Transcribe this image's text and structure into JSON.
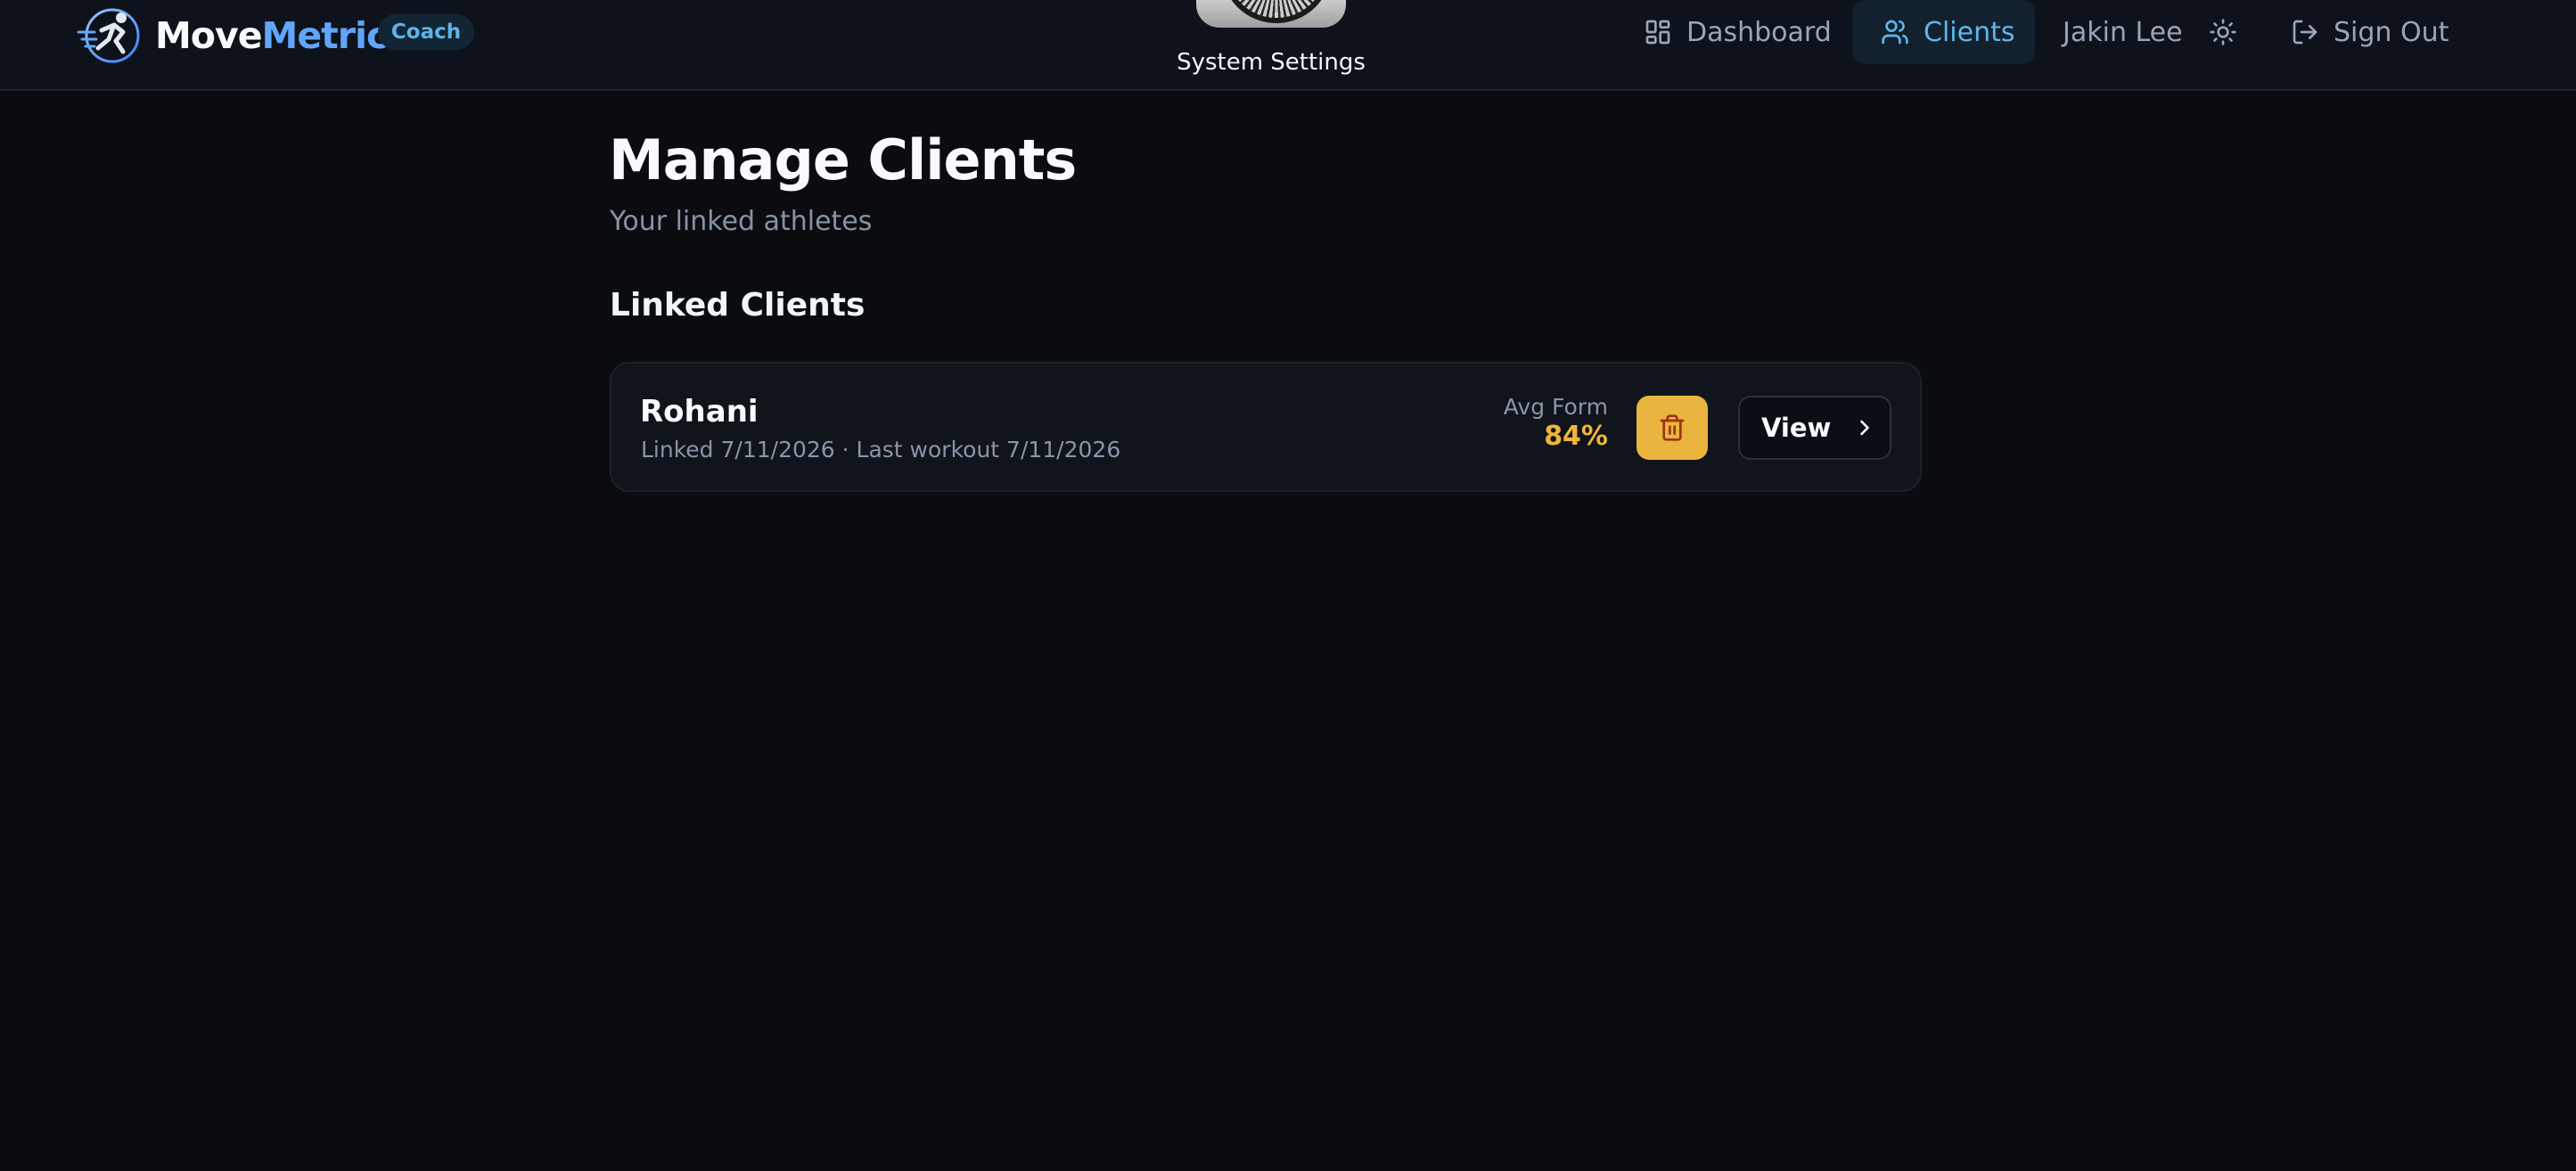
{
  "app": {
    "brand_part1": "Move",
    "brand_part2": "Metric",
    "role_badge": "Coach"
  },
  "system_overlay": {
    "label": "System Settings",
    "icon": "gear-icon"
  },
  "nav": {
    "dashboard_label": "Dashboard",
    "clients_label": "Clients",
    "active_item": "Clients",
    "user_name": "Jakin Lee",
    "theme_icon": "sun-icon",
    "signout_label": "Sign Out"
  },
  "page": {
    "title": "Manage Clients",
    "subtitle": "Your linked athletes",
    "section_title": "Linked Clients"
  },
  "clients": [
    {
      "name": "Rohani",
      "meta": "Linked 7/11/2026 · Last workout 7/11/2026",
      "avg_form_label": "Avg Form",
      "avg_form_value": "84%",
      "view_label": "View"
    }
  ],
  "colors": {
    "background": "#0a0c10",
    "header": "#0e121a",
    "accent_blue": "#5eb7ee",
    "brand_blue": "#60a5fa",
    "accent_amber": "#eab53e",
    "form_score": "#f0b43c"
  }
}
